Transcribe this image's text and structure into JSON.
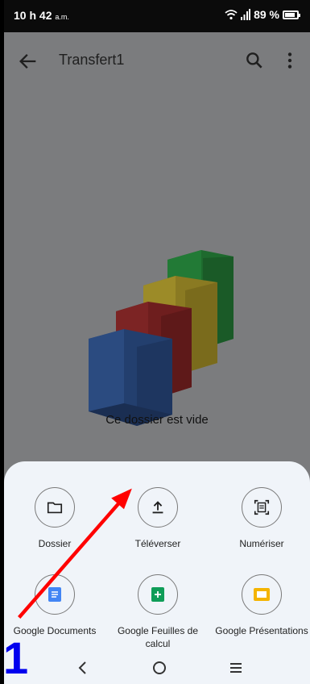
{
  "status": {
    "time": "10 h 42",
    "ampm": "a.m.",
    "battery": "89 %",
    "battery_level": 0.89
  },
  "topbar": {
    "title": "Transfert1"
  },
  "empty": {
    "message": "Ce dossier est vide"
  },
  "sheet": {
    "options": [
      {
        "label": "Dossier",
        "icon": "folder-icon"
      },
      {
        "label": "Téléverser",
        "icon": "upload-icon"
      },
      {
        "label": "Numériser",
        "icon": "scan-icon"
      },
      {
        "label": "Google Documents",
        "icon": "docs-icon",
        "color": "#4285f4"
      },
      {
        "label": "Google Feuilles de calcul",
        "icon": "sheets-icon",
        "color": "#0f9d58"
      },
      {
        "label": "Google Présentations",
        "icon": "slides-icon",
        "color": "#f4b400"
      }
    ]
  },
  "annotation": {
    "step_number": "1",
    "color": "#0000ee",
    "arrow_color": "#ff0000"
  }
}
